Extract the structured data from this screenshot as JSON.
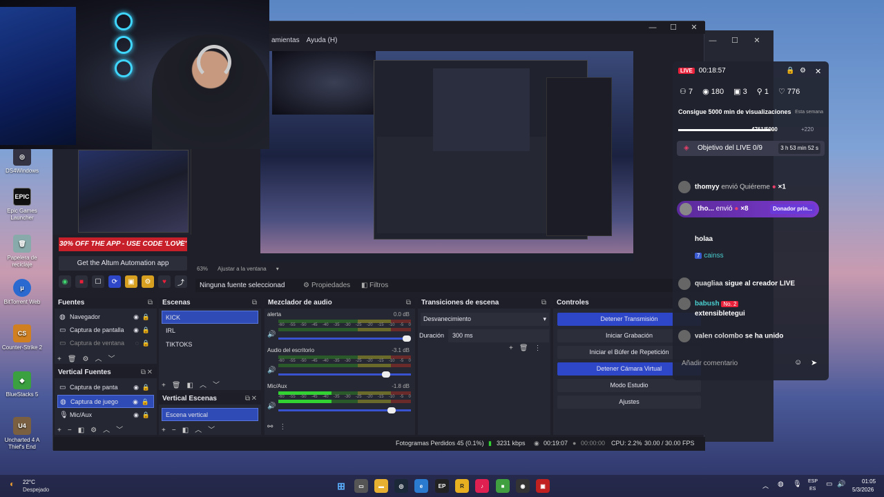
{
  "desktop": {
    "icons": [
      {
        "label": "DS4Windows",
        "color": "#334"
      },
      {
        "label": "Epic Games Launcher",
        "color": "#111"
      },
      {
        "label": "Papelera de reciclaje",
        "color": "#557"
      },
      {
        "label": "BitTorrent Web",
        "color": "#2a6ad0"
      },
      {
        "label": "Counter-Strike 2",
        "color": "#d08020"
      },
      {
        "label": "BlueStacks 5",
        "color": "#3aa040"
      },
      {
        "label": "Uncharted 4 A Thief's End",
        "color": "#7a6040"
      }
    ]
  },
  "obs": {
    "menu": [
      "amientas",
      "Ayuda (H)"
    ],
    "promo": "30% OFF THE APP - USE CODE 'LOVE'",
    "altum_button": "Get the Altum Automation app",
    "zoom": "63%",
    "fit": "Ajustar a la ventana",
    "context": {
      "no_source": "Ninguna fuente seleccionad",
      "properties": "Propiedades",
      "filters": "Filtros"
    },
    "sources": {
      "title": "Fuentes",
      "items": [
        "Navegador",
        "Captura de pantalla",
        "Captura de ventana"
      ]
    },
    "scenes": {
      "title": "Escenas",
      "items": [
        "KICK",
        "IRL",
        "TIKTOKS"
      ]
    },
    "vertical_sources": {
      "title": "Vertical Fuentes",
      "items": [
        "Captura de panta",
        "Captura de juego",
        "Mic/Aux"
      ]
    },
    "vertical_scenes": {
      "title": "Vertical Escenas",
      "items": [
        "Escena vertical"
      ]
    },
    "mixer": {
      "title": "Mezclador de audio",
      "channels": [
        {
          "name": "alerta",
          "db": "0.0 dB",
          "level": 0
        },
        {
          "name": "Audio del escritorio",
          "db": "-3.1 dB",
          "level": 0
        },
        {
          "name": "Mic/Aux",
          "db": "-1.8 dB",
          "level": 0.4
        }
      ],
      "scale": [
        "-60",
        "-55",
        "-50",
        "-45",
        "-40",
        "-35",
        "-30",
        "-25",
        "-20",
        "-15",
        "-10",
        "-5",
        "0"
      ]
    },
    "transitions": {
      "title": "Transiciones de escena",
      "selected": "Desvanecimiento",
      "duration_label": "Duración",
      "duration_value": "300 ms"
    },
    "controls": {
      "title": "Controles",
      "buttons": [
        "Detener Transmisión",
        "Iniciar Grabación",
        "Iniciar el Búfer de Repetición",
        "Detener Cámara Virtual",
        "Modo Estudio",
        "Ajustes"
      ]
    },
    "status": {
      "dropped": "Fotogramas Perdidos 45 (0.1%)",
      "kbps": "3231 kbps",
      "live_time": "00:19:07",
      "rec_time": "00:00:00",
      "cpu": "CPU: 2.2%",
      "fps": "30.00 / 30.00 FPS"
    }
  },
  "chat": {
    "live": "LIVE",
    "timer": "00:18:57",
    "stats": [
      "7",
      "180",
      "3",
      "1",
      "776"
    ],
    "goal_title": "Consigue 5000 min de visualizaciones",
    "goal_week": "Esta semana",
    "goal_progress": "4761/5000",
    "goal_bonus": "+220",
    "goal_fraction": 0.952,
    "objective": "Objetivo del LIVE 0/9",
    "objective_time": "3 h 53 min 52 s",
    "messages": [
      {
        "user": "thomyy",
        "text": "envió Quiéreme",
        "extra": "×1"
      },
      {
        "user": "holaa",
        "text": "",
        "extra": ""
      },
      {
        "user": "cainss",
        "text": "",
        "extra": "7"
      },
      {
        "user": "quagliaa",
        "text": "sigue al creador LIVE",
        "extra": ""
      },
      {
        "user": "babush",
        "text": "extensibletegui",
        "extra": "No. 2"
      },
      {
        "user": "valen colombo",
        "text": "se ha unido",
        "extra": ""
      }
    ],
    "donor": {
      "user": "tho...",
      "text": "envió",
      "count": "×8",
      "tag": "Donador prin..."
    },
    "comment_placeholder": "Añadir comentario"
  },
  "taskbar": {
    "weather_temp": "22°C",
    "weather_desc": "Despejado",
    "lang1": "ESP",
    "lang2": "ES",
    "time": "01:05",
    "date": "5/3/2026"
  }
}
